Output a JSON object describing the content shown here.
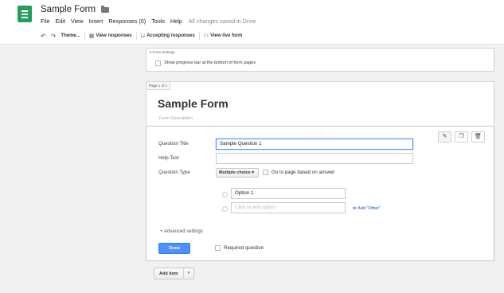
{
  "header": {
    "title": "Sample Form",
    "menu": [
      "File",
      "Edit",
      "View",
      "Insert",
      "Responses (0)",
      "Tools",
      "Help"
    ],
    "status": "All changes saved in Drive"
  },
  "toolbar": {
    "undo_icon": "undo-icon",
    "redo_icon": "redo-icon",
    "theme_label": "Theme...",
    "view_responses_label": "View responses",
    "accepting_label": "Accepting responses",
    "live_form_label": "View live form"
  },
  "settings": {
    "header": "▾ Form Settings",
    "progress_label": "Show progress bar at the bottom of form pages"
  },
  "page": {
    "tab": "Page 1 of 1",
    "form_title": "Sample Form",
    "form_description": "Form Description"
  },
  "question": {
    "title_label": "Question Title",
    "title_value": "Sample Question 1",
    "help_label": "Help Text",
    "help_value": "",
    "type_label": "Question Type",
    "type_value": "Multiple choice",
    "go_to_page_label": "Go to page based on answer",
    "option1": "Option 1",
    "add_option_placeholder": "Click to add option",
    "or_label": "or",
    "add_other_label": "Add \"Other\"",
    "advanced_label": "+ Advanced settings",
    "done_label": "Done",
    "required_label": "Required question"
  },
  "add_item": {
    "label": "Add item",
    "caret": "▾"
  },
  "colors": {
    "brand_green": "#22a05a",
    "accent_blue": "#4d90fe",
    "link_blue": "#1155cc"
  }
}
